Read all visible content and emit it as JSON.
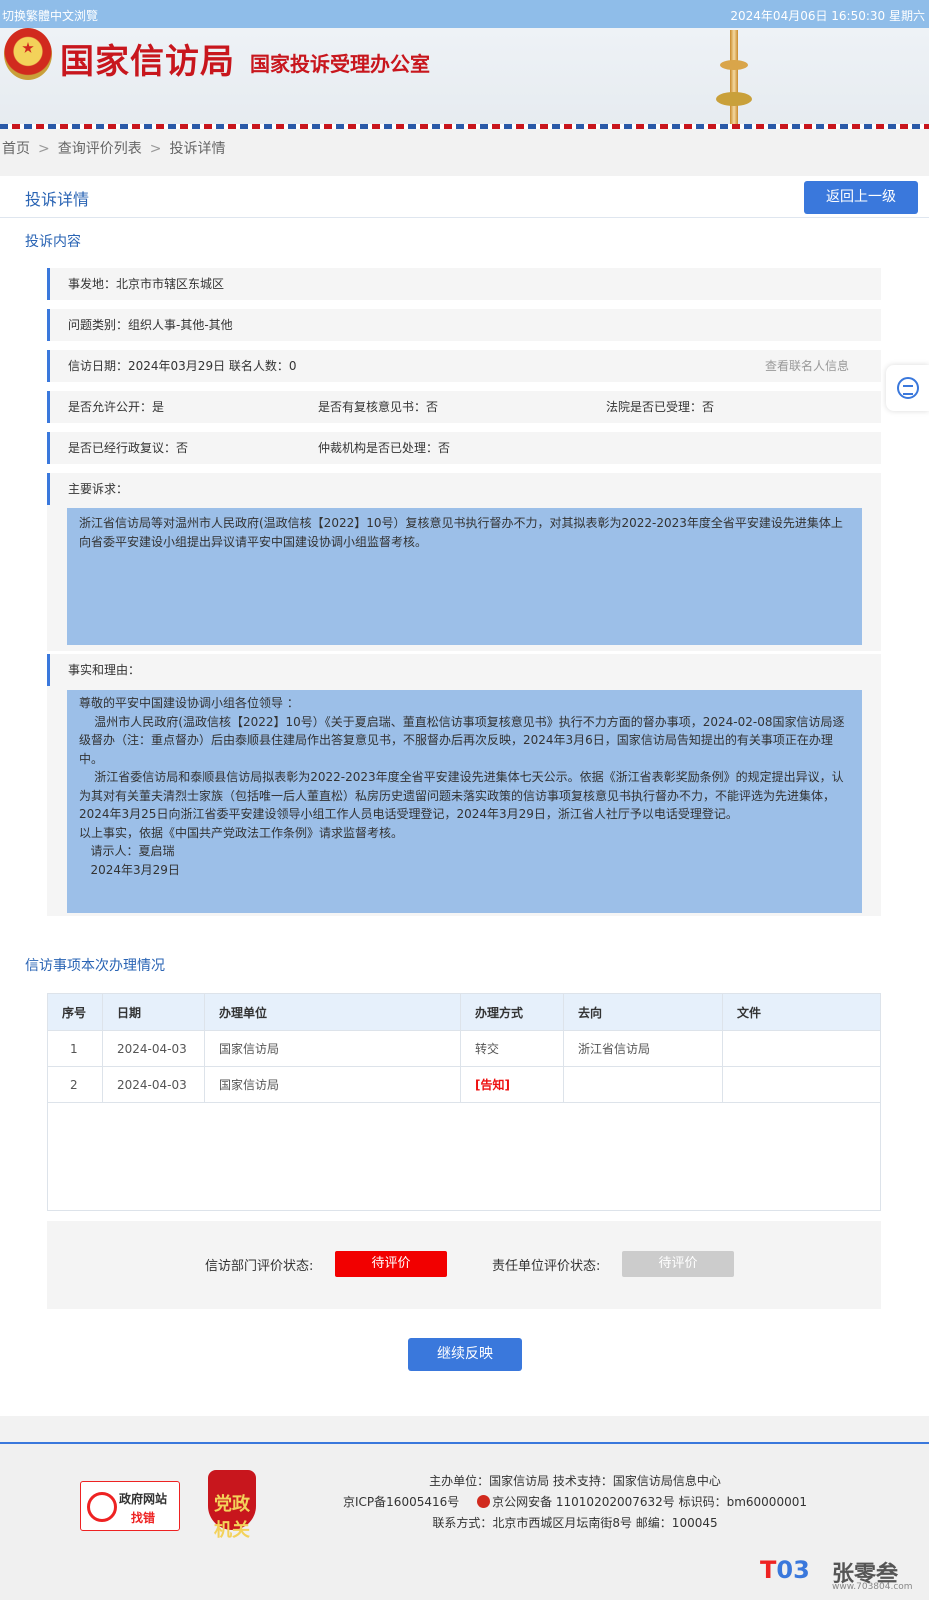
{
  "topbar": {
    "left_link": "切换繁體中文浏覽",
    "datetime": "2024年04月06日  16:50:30  星期六"
  },
  "header": {
    "title": "国家信访局",
    "subtitle": "国家投诉受理办公室"
  },
  "breadcrumb": {
    "home": "首页",
    "sep1": ">",
    "list": "查询评价列表",
    "sep2": ">",
    "current": "投诉详情"
  },
  "page": {
    "title": "投诉详情",
    "back_button": "返回上一级"
  },
  "complaint": {
    "section_title": "投诉内容",
    "location": "事发地：北京市市辖区东城区",
    "category": "问题类别：组织人事-其他-其他",
    "date_contacts": "信访日期：2024年03月29日  联名人数：0",
    "contact_link": "查看联名人信息",
    "allow_public": "是否允许公开：是",
    "review_opinion": "是否有复核意见书：否",
    "court_accepted": "法院是否已受理：否",
    "admin_review": "是否已经行政复议：否",
    "arbitration": "仲裁机构是否已处理：否",
    "main_claim_label": "主要诉求：",
    "main_claim": "浙江省信访局等对温州市人民政府(温政信核【2022】10号）复核意见书执行督办不力，对其拟表彰为2022-2023年度全省平安建设先进集体上向省委平安建设小组提出异议请平安中国建设协调小组监督考核。",
    "facts_label": "事实和理由：",
    "facts": [
      "尊敬的平安中国建设协调小组各位领导 ：",
      "    温州市人民政府(温政信核【2022】10号）《关于夏启瑞、董直松信访事项复核意见书》执行不力方面的督办事项，2024-02-08国家信访局逐级督办（注：重点督办）后由泰顺县住建局作出答复意见书，不服督办后再次反映，2024年3月6日，国家信访局告知提出的有关事项正在办理中。",
      "    浙江省委信访局和泰顺县信访局拟表彰为2022-2023年度全省平安建设先进集体七天公示。依据《浙江省表彰奖励条例》的规定提出异议，认为其对有关董夫清烈士家族（包括唯一后人董直松）私房历史遗留问题未落实政策的信访事项复核意见书执行督办不力，不能评选为先进集体，2024年3月25日向浙江省委平安建设领导小组工作人员电话受理登记，2024年3月29日，浙江省人社厅予以电话受理登记。",
      "以上事实，依据《中国共产党政法工作条例》请求监督考核。",
      "   请示人：夏启瑞",
      "   2024年3月29日"
    ]
  },
  "handling": {
    "section_title": "信访事项本次办理情况",
    "columns": [
      "序号",
      "日期",
      "办理单位",
      "办理方式",
      "去向",
      "文件"
    ],
    "rows": [
      [
        "1",
        "2024-04-03",
        "国家信访局",
        "转交",
        "浙江省信访局",
        ""
      ],
      [
        "2",
        "2024-04-03",
        "国家信访局",
        "[告知]",
        "",
        ""
      ]
    ]
  },
  "evaluation": {
    "dept_label": "信访部门评价状态:",
    "dept_status": "待评价",
    "resp_label": "责任单位评价状态:",
    "resp_status": "待评价",
    "continue_button": "继续反映",
    "colors": {
      "dept": "#f20000",
      "resp": "#cccccc"
    }
  },
  "footer": {
    "badge1_top": "政府网站",
    "badge1_bottom": "找错",
    "badge2": "党政机关",
    "line1": "主办单位：国家信访局    技术支持：国家信访局信息中心",
    "line2_a": "京ICP备16005416号",
    "line2_b": "京公网安备 11010202007632号    标识码：bm60000001",
    "line3": "联系方式：北京市西城区月坛南街8号    邮编：100045",
    "watermark": "张零叁",
    "watermark_url": "www.703804.com"
  },
  "icons": [
    "emblem-icon",
    "tower-icon",
    "feedback-icon",
    "search-icon",
    "police-icon"
  ],
  "colors": {
    "accent": "#3a78dc",
    "topbar": "#8fbde9",
    "brand_red": "#c8161d",
    "text_box": "#9cbfe8"
  }
}
